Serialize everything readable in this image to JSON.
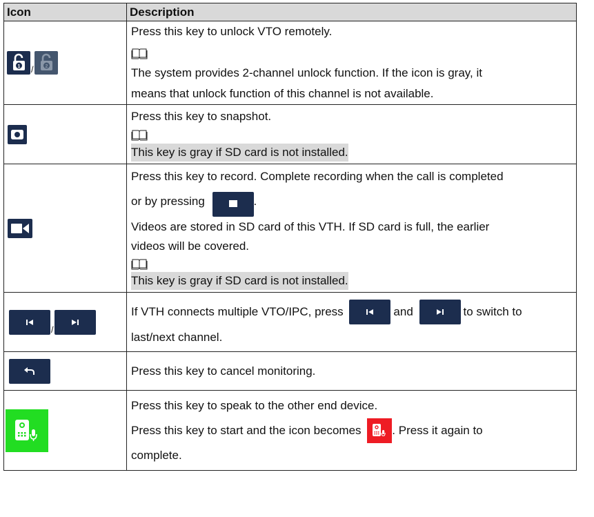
{
  "header": {
    "col_icon": "Icon",
    "col_description": "Description"
  },
  "separator": "/",
  "rows": [
    {
      "icons": [
        "unlock-1-icon",
        "unlock-2-icon"
      ],
      "lines": [
        "Press this key to unlock VTO remotely.",
        "The system provides 2-channel unlock function. If the icon is gray, it",
        "means that unlock function of this channel is not available."
      ]
    },
    {
      "icons": [
        "camera-icon"
      ],
      "lines": [
        "Press this key to snapshot.",
        "This key is gray if SD card is not installed."
      ]
    },
    {
      "icons": [
        "video-camera-icon",
        "stop-icon"
      ],
      "lines": [
        "Press this key to record. Complete recording when the call is completed",
        "or by pressing",
        ".",
        "Videos are stored in SD card of this VTH. If SD card is full, the earlier",
        "videos will be covered.",
        "This key is gray if SD card is not installed."
      ]
    },
    {
      "icons": [
        "previous-channel-icon",
        "next-channel-icon"
      ],
      "lines": [
        "If VTH connects multiple VTO/IPC, press",
        "and",
        "to switch to",
        "last/next channel."
      ]
    },
    {
      "icons": [
        "back-arrow-icon"
      ],
      "lines": [
        "Press this key to cancel monitoring."
      ]
    },
    {
      "icons": [
        "talk-icon",
        "talk-active-icon"
      ],
      "lines": [
        "Press this key to speak to the other end device.",
        "Press this key to start and the icon becomes",
        ". Press it again to",
        "complete."
      ]
    }
  ],
  "colors": {
    "navy": "#1c2d4e",
    "green": "#22dd22",
    "red": "#ee1c24",
    "header_gray": "#d9d9d9"
  }
}
